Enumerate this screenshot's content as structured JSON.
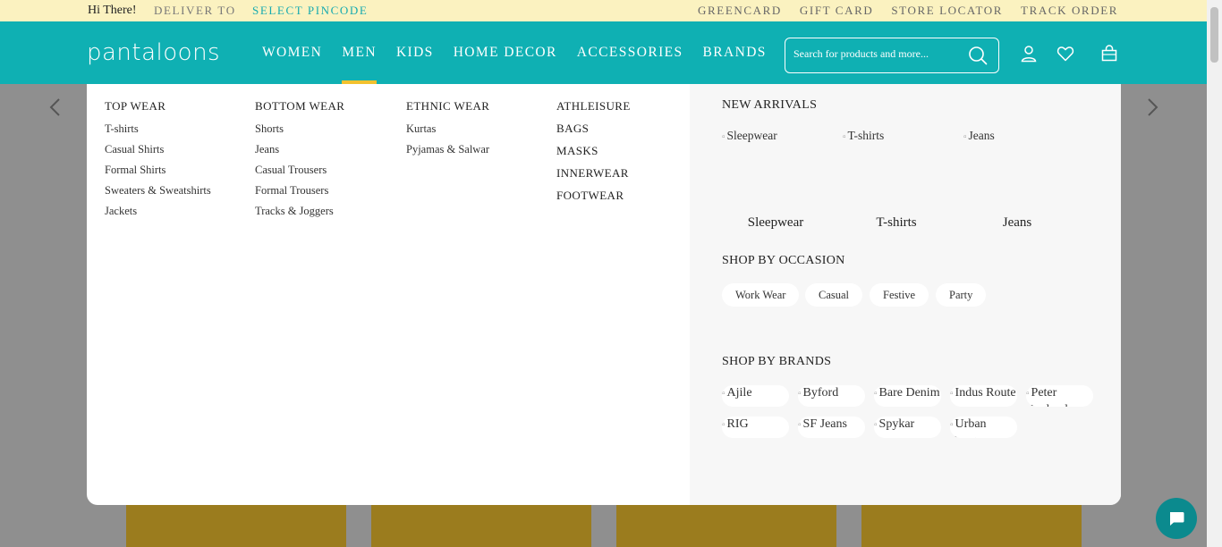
{
  "topbar": {
    "greeting": "Hi There!",
    "deliver_to": "DELIVER TO",
    "select_pincode": "SELECT PINCODE",
    "links": [
      "GREENCARD",
      "GIFT CARD",
      "STORE LOCATOR",
      "TRACK ORDER"
    ]
  },
  "nav": {
    "logo": "pantaloons",
    "menu": [
      "WOMEN",
      "MEN",
      "KIDS",
      "HOME DECOR",
      "ACCESSORIES",
      "BRANDS"
    ],
    "active": "MEN",
    "search_placeholder": "Search for products and more...",
    "icons": [
      "account-icon",
      "wishlist-icon",
      "cart-icon"
    ]
  },
  "mega": {
    "top_wear": {
      "title": "TOP WEAR",
      "items": [
        "T-shirts",
        "Casual Shirts",
        "Formal Shirts",
        "Sweaters & Sweatshirts",
        "Jackets"
      ]
    },
    "bottom_wear": {
      "title": "BOTTOM WEAR",
      "items": [
        "Shorts",
        "Jeans",
        "Casual Trousers",
        "Formal Trousers",
        "Tracks & Joggers"
      ]
    },
    "ethnic_wear": {
      "title": "ETHNIC WEAR",
      "items": [
        "Kurtas",
        "Pyjamas & Salwar"
      ]
    },
    "others": [
      "ATHLEISURE",
      "BAGS",
      "MASKS",
      "INNERWEAR",
      "FOOTWEAR"
    ]
  },
  "new_arrivals": {
    "title": "NEW ARRIVALS",
    "items": [
      {
        "alt": "Sleepwear",
        "caption": "Sleepwear"
      },
      {
        "alt": "T-shirts",
        "caption": "T-shirts"
      },
      {
        "alt": "Jeans",
        "caption": "Jeans"
      }
    ]
  },
  "occasion": {
    "title": "SHOP BY OCCASION",
    "items": [
      "Work Wear",
      "Casual",
      "Festive",
      "Party"
    ]
  },
  "brands": {
    "title": "SHOP BY BRANDS",
    "items": [
      "Ajile",
      "Byford",
      "Bare Denim",
      "Indus Route",
      "Peter England",
      "RIG",
      "SF Jeans",
      "Spykar",
      "Urban Ranger"
    ]
  },
  "colors": {
    "teal": "#0fb0b3",
    "cream": "#fbf2c0",
    "accent": "#f2c12e",
    "mustard": "#9b7c1e"
  }
}
